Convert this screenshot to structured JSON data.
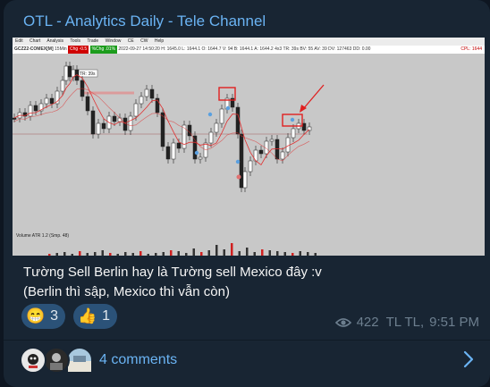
{
  "channel": {
    "title": "OTL - Analytics Daily - Tele Channel"
  },
  "chart": {
    "menu": [
      "Edit",
      "Chart",
      "Analysis",
      "Tools",
      "Trade",
      "Window",
      "CE",
      "CW",
      "Help"
    ],
    "ticker": "GCZ22-COMEX[M]",
    "timeframe": "15Min",
    "info_last": "Chg -0.5",
    "info_pct": "%Chg .01%",
    "info_text": "2022-09-27 14:50:20 H: 1645.0 L: 1644.1 O: 1644.7 V: 94 B: 1644.1 A: 1644.2 4x3 TR: 39s BV: 55 AV: 39 DV: 127463 DD: 0.00",
    "cpl_label": "CPL: 1644",
    "tr_label": "TR: 39s",
    "volume_label": "Volume ATR 1.2 (Smp. 48)",
    "colors": {
      "up": "#ffffff",
      "down": "#222222",
      "ma": "#e03030",
      "highlight": "#e02020",
      "grid_line": "#b08080"
    }
  },
  "message": {
    "line1": "Tường Sell Berlin hay là Tường sell Mexico đây :v",
    "line2": "(Berlin thì sập, Mexico thì vẫn còn)"
  },
  "reactions": [
    {
      "emoji": "😁",
      "count": "3",
      "icon": "grinning-face-icon"
    },
    {
      "emoji": "👍",
      "count": "1",
      "icon": "thumbs-up-icon"
    }
  ],
  "meta": {
    "views": "422",
    "author": "TL TL",
    "time": "9:51 PM"
  },
  "comments": {
    "label": "4 comments"
  }
}
